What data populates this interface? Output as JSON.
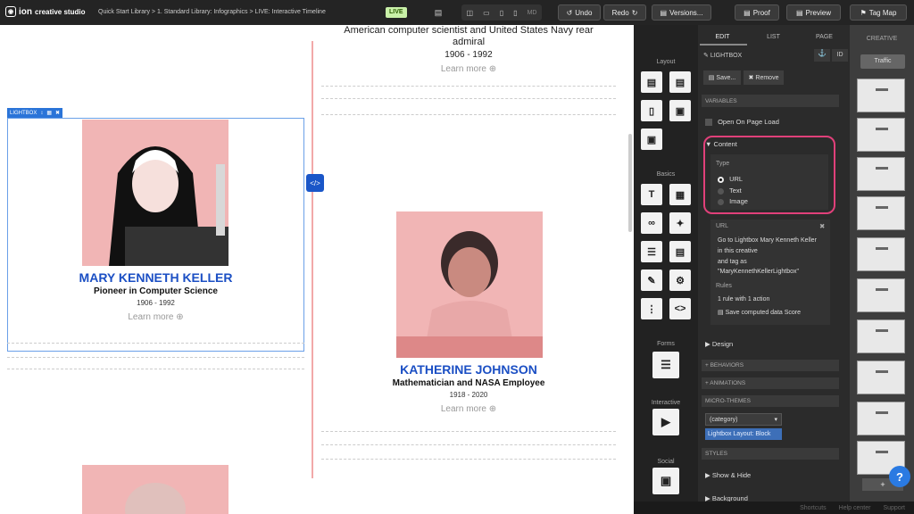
{
  "topbar": {
    "logo_mark": "ion",
    "logo_text": "creative studio",
    "breadcrumb": "Quick Start Library > 1. Standard Library: Infographics > LIVE: Interactive Timeline",
    "live_badge": "LIVE",
    "device_size": "MD",
    "undo_label": "Undo",
    "redo_label": "Redo",
    "versions_label": "Versions...",
    "proof_label": "Proof",
    "preview_label": "Preview",
    "tagmap_label": "Tag Map"
  },
  "canvas": {
    "top_entry": {
      "line1": "American computer scientist and United States Navy rear",
      "line2": "admiral",
      "years": "1906 - 1992",
      "learn_more": "Learn more"
    },
    "lightbox_tag": "LIGHTBOX",
    "entry_left": {
      "name": "MARY KENNETH KELLER",
      "role": "Pioneer in Computer Science",
      "years": "1906 - 1992",
      "learn_more": "Learn more"
    },
    "entry_right": {
      "name": "KATHERINE JOHNSON",
      "role": "Mathematician and NASA Employee",
      "years": "1918 - 2020",
      "learn_more": "Learn more"
    }
  },
  "tools": {
    "layout_title": "Layout",
    "basics_title": "Basics",
    "forms_title": "Forms",
    "interactive_title": "Interactive",
    "social_title": "Social"
  },
  "props": {
    "tabs": [
      "EDIT",
      "LIST",
      "PAGE"
    ],
    "element_title": "LIGHTBOX",
    "id_label": "ID",
    "save_label": "Save...",
    "remove_label": "Remove",
    "variables_header": "VARIABLES",
    "open_on_load": "Open On Page Load",
    "content_title": "Content",
    "type_label": "Type",
    "type_options": [
      "URL",
      "Text",
      "Image"
    ],
    "url_label": "URL",
    "url_desc1": "Go to Lightbox Mary Kenneth Keller",
    "url_desc2": "in this creative",
    "url_desc3": "and tag as",
    "url_desc4": "\"MaryKennethKellerLightbox\"",
    "rules_label": "Rules",
    "rules_desc": "1 rule with 1 action",
    "rules_save": "Save computed data Score",
    "design_label": "Design",
    "behaviors_header": "+ BEHAVIORS",
    "animations_header": "+ ANIMATIONS",
    "microthemes_header": "MICRO-THEMES",
    "category_select": "(category)",
    "microtheme_tag": "Lightbox Layout: Block",
    "styles_header": "STYLES",
    "show_hide": "Show & Hide",
    "background": "Background"
  },
  "thumbs": {
    "title": "CREATIVE",
    "traffic_label": "Traffic",
    "add_label": "+"
  },
  "bottom": {
    "shortcuts": "Shortcuts",
    "help_center": "Help center",
    "support": "Support",
    "help_button": "?"
  }
}
